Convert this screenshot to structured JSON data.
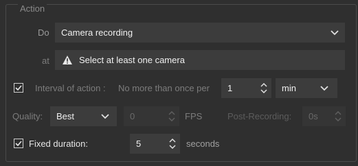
{
  "section": {
    "title": "Action"
  },
  "do": {
    "label": "Do",
    "value": "Camera recording"
  },
  "at": {
    "label": "at",
    "value": "Select at least one camera"
  },
  "interval": {
    "label": "Interval of action :",
    "limit_text": "No more than once per",
    "value": "1",
    "unit": "min",
    "checked": true
  },
  "quality": {
    "label": "Quality:",
    "value": "Best",
    "fps_value": "0",
    "fps_label": "FPS",
    "post_label": "Post-Recording:",
    "post_value": "0s"
  },
  "fixed": {
    "label": "Fixed duration:",
    "value": "5",
    "unit": "seconds",
    "checked": true
  },
  "icons": [
    "warning-icon",
    "chevron-down-icon",
    "spinner-arrows-icon",
    "checkmark-icon"
  ]
}
